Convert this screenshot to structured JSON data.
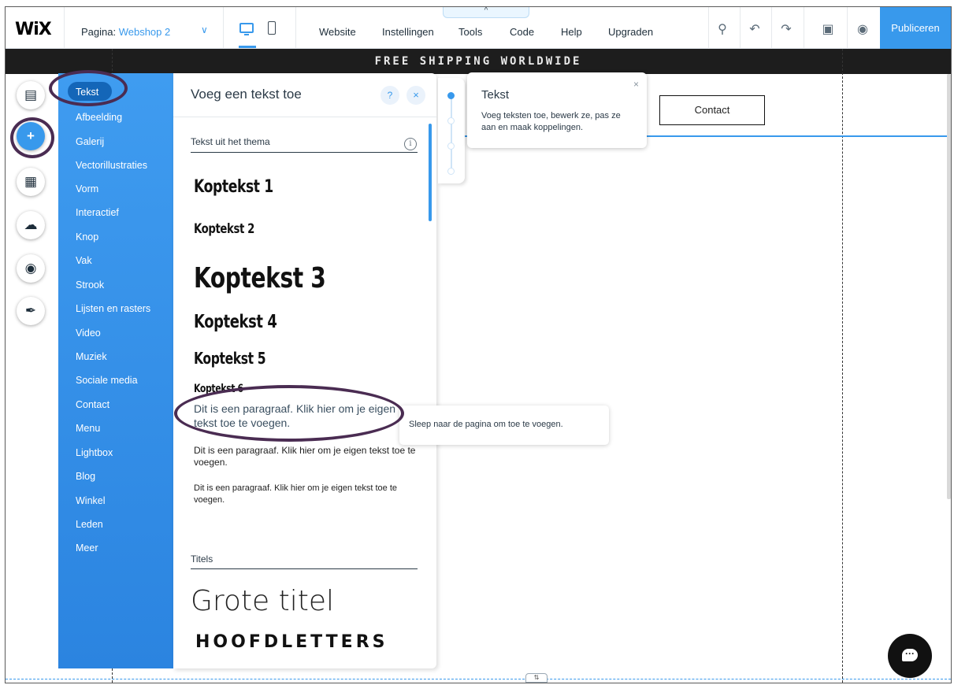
{
  "topbar": {
    "logo": "WiX",
    "page_prefix": "Pagina: ",
    "page_name": "Webshop 2",
    "menu": [
      "Website",
      "Instellingen",
      "Tools",
      "Code",
      "Help",
      "Upgraden"
    ],
    "collapse_glyph": "^",
    "publish": "Publiceren"
  },
  "canvas": {
    "banner": "FREE SHIPPING WORLDWIDE",
    "contact_button": "Contact",
    "bottom_handle": "⇅"
  },
  "add_panel": {
    "categories": [
      "Tekst",
      "Afbeelding",
      "Galerij",
      "Vectorillustraties",
      "Vorm",
      "Interactief",
      "Knop",
      "Vak",
      "Strook",
      "Lijsten en rasters",
      "Video",
      "Muziek",
      "Sociale media",
      "Contact",
      "Menu",
      "Lightbox",
      "Blog",
      "Winkel",
      "Leden",
      "Meer"
    ],
    "active_category": "Tekst",
    "title": "Voeg een tekst toe",
    "help": "?",
    "close": "×",
    "theme_section": "Tekst uit het thema",
    "info": "i",
    "headings": [
      "Koptekst 1",
      "Koptekst 2",
      "Koptekst 3",
      "Koptekst 4",
      "Koptekst 5",
      "Koptekst 6"
    ],
    "paragraph_large": "Dit is een paragraaf. Klik hier om je eigen tekst toe te voegen.",
    "paragraph_medium": "Dit is een paragraaf. Klik hier om je eigen tekst toe te voegen.",
    "paragraph_small": "Dit is een paragraaf. Klik hier om je eigen tekst toe te voegen.",
    "titles_section": "Titels",
    "big_title": "Grote titel",
    "caps_title": "HOOFDLETTERS"
  },
  "tooltip": {
    "title": "Tekst",
    "body": "Voeg teksten toe, bewerk ze, pas ze aan en maak koppelingen.",
    "close": "×"
  },
  "drag_hint": "Sleep naar de pagina om toe te voegen.",
  "icons": {
    "left_bar": [
      "pages-icon",
      "add-icon",
      "app-market-icon",
      "upload-icon",
      "chat-icon",
      "blog-pen-icon"
    ],
    "tools": [
      "zoom-icon",
      "undo-icon",
      "redo-icon",
      "save-icon",
      "preview-icon"
    ]
  },
  "colors": {
    "accent": "#3899ec",
    "annotation": "#4a2c52",
    "banner_bg": "#1d1d1d"
  }
}
